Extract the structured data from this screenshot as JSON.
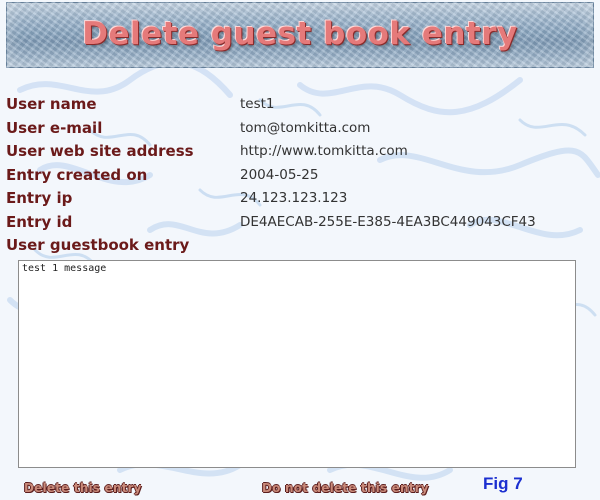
{
  "banner": {
    "title": "Delete guest book entry"
  },
  "fields": [
    {
      "label": "User name",
      "value": "test1"
    },
    {
      "label": "User e-mail",
      "value": "tom@tomkitta.com"
    },
    {
      "label": "User web site address",
      "value": "http://www.tomkitta.com"
    },
    {
      "label": "Entry created on",
      "value": "2004-05-25"
    },
    {
      "label": "Entry ip",
      "value": "24.123.123.123"
    },
    {
      "label": "Entry id",
      "value": "DE4AECAB-255E-E385-4EA3BC449043CF43"
    }
  ],
  "entry": {
    "label": "User guestbook entry",
    "text": "test 1 message"
  },
  "actions": {
    "delete_label": "Delete this entry",
    "keep_label": "Do not delete this entry"
  },
  "figure_label": "Fig 7",
  "colors": {
    "label": "#6b1a1a",
    "banner_title": "#e57a7a",
    "figure": "#1b2fd0"
  }
}
